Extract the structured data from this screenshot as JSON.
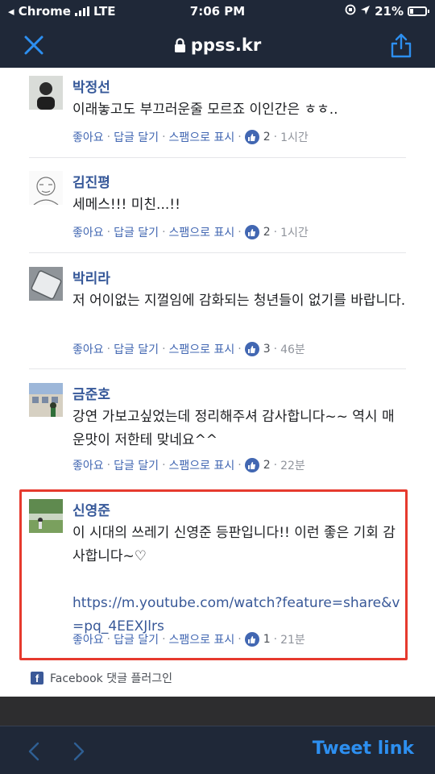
{
  "status_bar": {
    "carrier": "◂ Chrome",
    "network": "LTE",
    "time": "7:06 PM",
    "battery": "21%"
  },
  "nav": {
    "url": "ppss.kr"
  },
  "comment_actions": {
    "like": "좋아요",
    "reply": "답글 달기",
    "spam": "스팸으로 표시",
    "separator": "·"
  },
  "comments": [
    {
      "author": "박정선",
      "text": "이래놓고도 부끄러운줄 모르죠 이인간은 ㅎㅎ..",
      "likes": "2",
      "time": "1시간"
    },
    {
      "author": "김진평",
      "text": "세메스!!! 미친...!!",
      "likes": "2",
      "time": "1시간"
    },
    {
      "author": "박리라",
      "text": "저 어이없는 지껄임에 감화되는 청년들이 없기를 바랍니다.",
      "likes": "3",
      "time": "46분"
    },
    {
      "author": "금준호",
      "text": "강연 가보고싶었는데 정리해주셔 감사합니다~~ 역시 매운맛이 저한테 맞네요^^",
      "likes": "2",
      "time": "22분"
    },
    {
      "author": "신영준",
      "text": "이 시대의 쓰레기 신영준 등판입니다!! 이런 좋은 기회 감사합니다~♡",
      "link": "https://m.youtube.com/watch?feature=share&v=pq_4EEXJlrs",
      "likes": "1",
      "time": "21분"
    }
  ],
  "footer": {
    "fb_plugin": "Facebook 댓글 플러그인"
  },
  "toolbar": {
    "tweet_link": "Tweet link"
  },
  "colors": {
    "chrome_bg": "#1f2838",
    "accent": "#2d8ff0",
    "author": "#365899",
    "highlight": "#e63a2e"
  }
}
